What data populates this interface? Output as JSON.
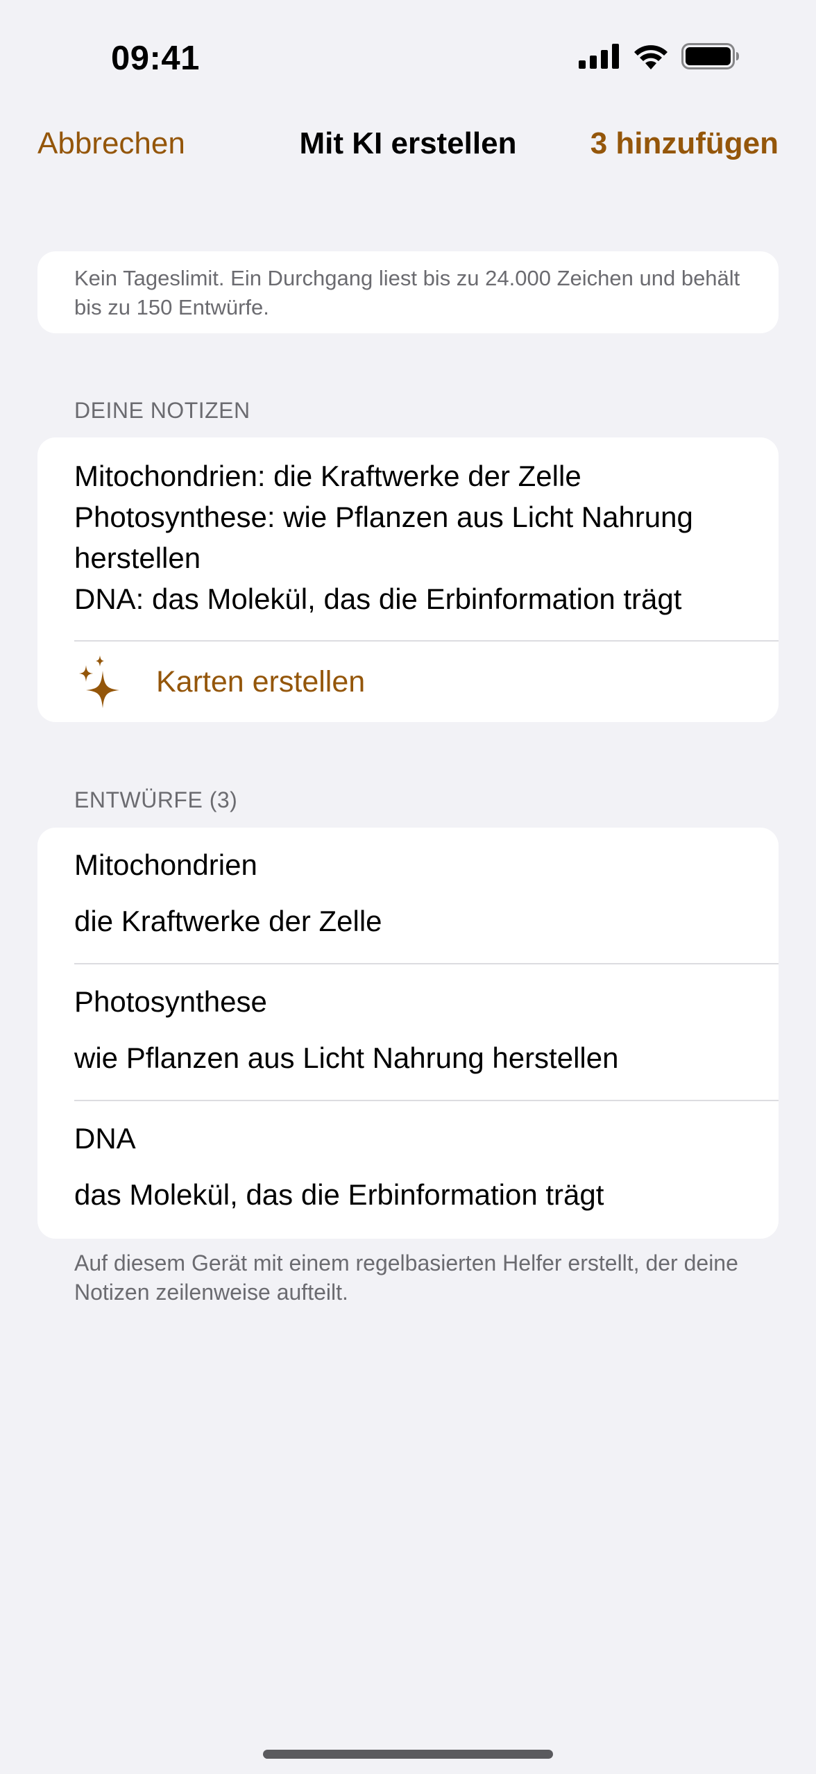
{
  "status_bar": {
    "time": "09:41"
  },
  "nav": {
    "cancel_label": "Abbrechen",
    "title": "Mit KI erstellen",
    "add_label": "3 hinzufügen"
  },
  "info": {
    "text": "Kein Tageslimit. Ein Durchgang liest bis zu 24.000 Zeichen und behält bis zu 150 Entwürfe."
  },
  "notes": {
    "header": "DEINE NOTIZEN",
    "text": "Mitochondrien: die Kraftwerke der Zelle\nPhotosynthese: wie Pflanzen aus Licht Nahrung herstellen\nDNA: das Molekül, das die Erbinformation trägt",
    "create_label": "Karten erstellen"
  },
  "drafts": {
    "header": "ENTWÜRFE (3)",
    "items": [
      {
        "front": "Mitochondrien",
        "back": "die Kraftwerke der Zelle"
      },
      {
        "front": "Photosynthese",
        "back": "wie Pflanzen aus Licht Nahrung herstellen"
      },
      {
        "front": "DNA",
        "back": "das Molekül, das die Erbinformation trägt"
      }
    ]
  },
  "footer": {
    "text": "Auf diesem Gerät mit einem regelbasierten Helfer erstellt, der deine Notizen zeilenweise aufteilt."
  },
  "colors": {
    "accent": "#94560a",
    "background": "#f2f2f6",
    "secondary_text": "#6b6b70"
  },
  "icons": {
    "signal": "cellular-signal-icon",
    "wifi": "wifi-icon",
    "battery": "battery-icon",
    "sparkle": "sparkles-icon"
  }
}
